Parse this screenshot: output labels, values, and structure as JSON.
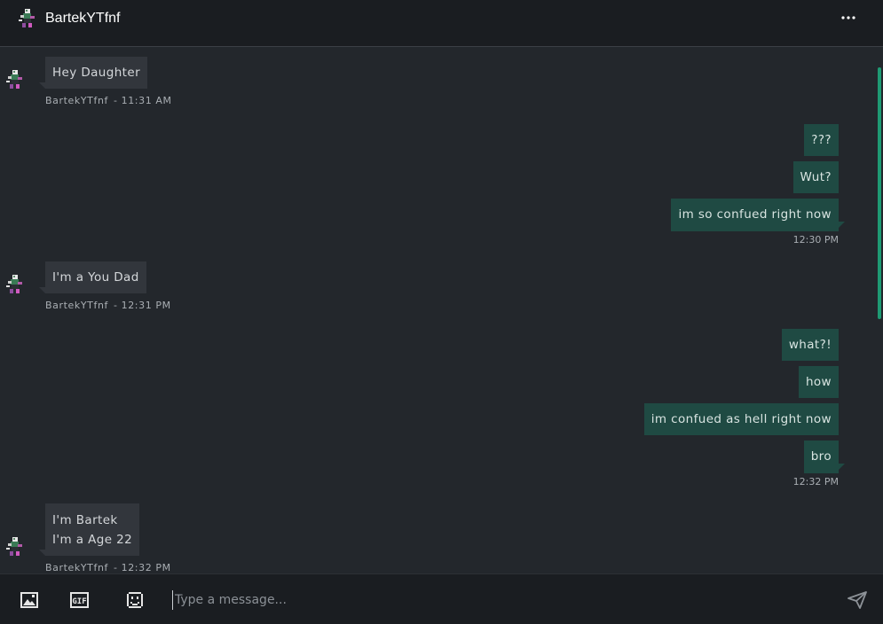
{
  "header": {
    "title": "BartekYTfnf",
    "avatar_icon": "pixel-character-avatar",
    "menu_icon": "more-horizontal-icon"
  },
  "messages": [
    {
      "direction": "in",
      "lines": [
        "Hey Daughter"
      ],
      "sender": "BartekYTfnf",
      "time": "11:31 AM"
    },
    {
      "direction": "out",
      "lines": [
        "???"
      ]
    },
    {
      "direction": "out",
      "lines": [
        "Wut?"
      ]
    },
    {
      "direction": "out",
      "lines": [
        "im so confued right now"
      ],
      "time": "12:30 PM"
    },
    {
      "direction": "in",
      "lines": [
        "I'm a You Dad"
      ],
      "sender": "BartekYTfnf",
      "time": "12:31 PM"
    },
    {
      "direction": "out",
      "lines": [
        "what?!"
      ]
    },
    {
      "direction": "out",
      "lines": [
        "how"
      ]
    },
    {
      "direction": "out",
      "lines": [
        "im confued as hell right now"
      ]
    },
    {
      "direction": "out",
      "lines": [
        "bro"
      ],
      "time": "12:32 PM"
    },
    {
      "direction": "in",
      "lines": [
        "I'm Bartek",
        "I'm a Age 22"
      ],
      "sender": "BartekYTfnf",
      "time": "12:32 PM"
    }
  ],
  "meta_separator": "-",
  "composer": {
    "placeholder": "Type a message...",
    "tools": [
      "image-icon",
      "gif-icon",
      "emoji-icon"
    ],
    "send_icon": "send-icon"
  },
  "colors": {
    "background": "#23272c",
    "header": "#1a1d21",
    "incoming_bubble": "#32363c",
    "outgoing_bubble": "#1f4a43",
    "scrollbar": "#1e9a73"
  }
}
